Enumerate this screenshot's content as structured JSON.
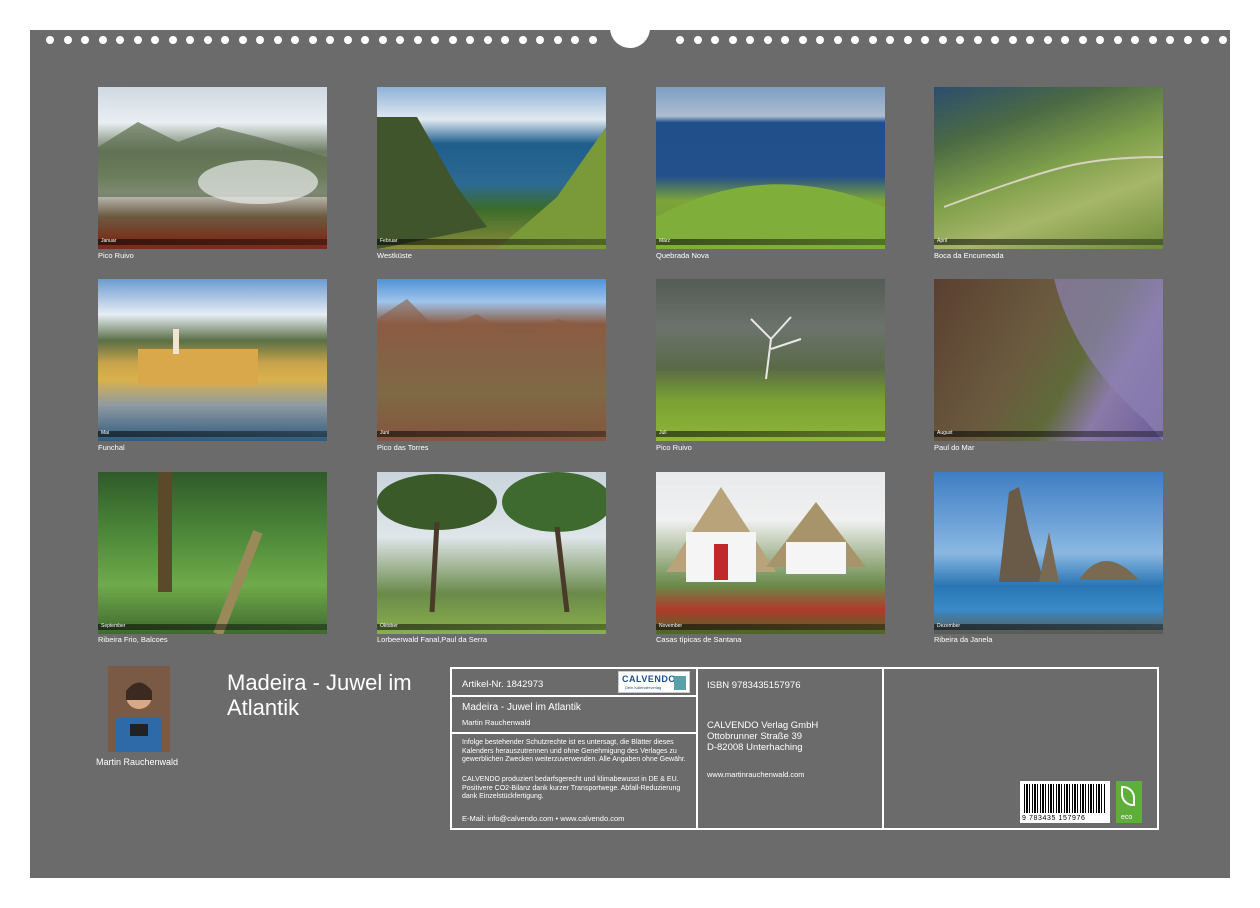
{
  "photos": [
    {
      "caption": "Pico Ruivo",
      "month": "Januar"
    },
    {
      "caption": "Westküste",
      "month": "Februar"
    },
    {
      "caption": "Quebrada Nova",
      "month": "März"
    },
    {
      "caption": "Boca da Encumeada",
      "month": "April"
    },
    {
      "caption": "Funchal",
      "month": "Mai"
    },
    {
      "caption": "Pico das Torres",
      "month": "Juni"
    },
    {
      "caption": "Pico Ruivo",
      "month": "Juli"
    },
    {
      "caption": "Paul do Mar",
      "month": "August"
    },
    {
      "caption": "Ribeira Frio, Balcoes",
      "month": "September"
    },
    {
      "caption": "Lorbeerwald Fanal,Paul da Serra",
      "month": "Oktober"
    },
    {
      "caption": "Casas típicas de Santana",
      "month": "November"
    },
    {
      "caption": "Ribeira da Janela",
      "month": "Dezember"
    }
  ],
  "author": {
    "name": "Martin Rauchenwald"
  },
  "calendar_title": "Madeira - Juwel im Atlantik",
  "info": {
    "article": "Artikel-Nr. 1842973",
    "logo_brand": "CALVENDO",
    "logo_tag": "Dein Kalenderverlag",
    "title": "Madeira - Juwel im Atlantik",
    "author": "Martin Rauchenwald",
    "legal": "Infolge bestehender Schutzrechte ist es untersagt, die Blätter dieses Kalenders herauszutrennen und ohne Genehmigung des Verlages zu gewerblichen Zwecken weiterzuverwenden. Alle Angaben ohne Gewähr.",
    "production": "CALVENDO produziert bedarfsgerecht und klimabewusst in DE & EU. Positivere CO2-Bilanz dank kurzer Transportwege. Abfall-Reduzierung dank Einzelstückfertigung.",
    "email": "E-Mail: info@calvendo.com • www.calvendo.com",
    "isbn": "ISBN 9783435157976",
    "publisher": "CALVENDO Verlag GmbH",
    "street": "Ottobrunner Straße 39",
    "city": "D-82008 Unterhaching",
    "website": "www.martinrauchenwald.com",
    "barcode_number": "9 783435 157976",
    "eco_label": "eco"
  },
  "colors": {
    "sheet": "#6b6b6b",
    "text": "#ffffff"
  }
}
